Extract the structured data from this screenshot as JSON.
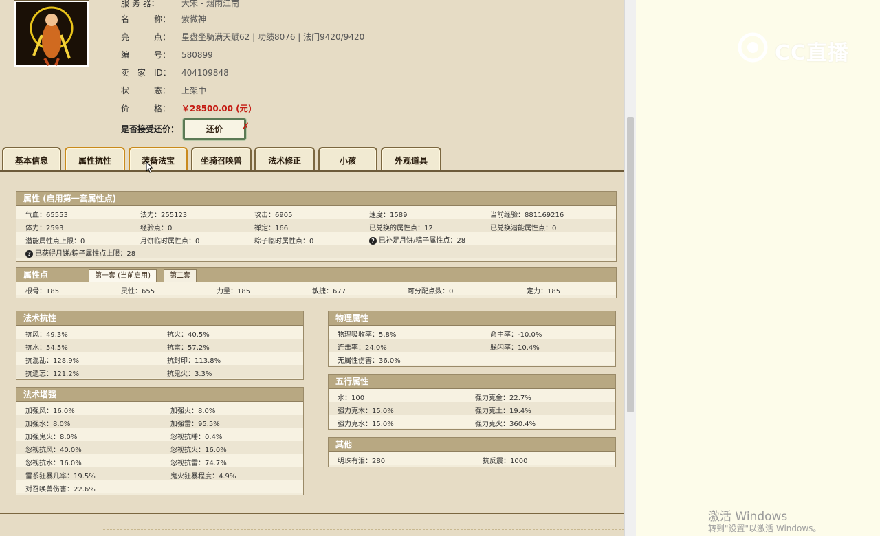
{
  "listing": {
    "server_label": "服 务 器：",
    "server_value": "大宋 - 烟雨江南",
    "name_label": "名　　　称：",
    "name_value": "紫微神",
    "highlight_label": "亮　　　点：",
    "highlight_value": "星盘坐骑满天赋62 | 功绩8076 | 法门9420/9420",
    "number_label": "编　　　号：",
    "number_value": "580899",
    "seller_label": "卖　家　ID：",
    "seller_value": "404109848",
    "status_label": "状　　　态：",
    "status_value": "上架中",
    "price_label": "价　　　格：",
    "price_value": "￥28500.00 (元)",
    "bargain_label": "是否接受还价：",
    "bargain_button": "还价",
    "bargain_x": "✗"
  },
  "tabs": [
    "基本信息",
    "属性抗性",
    "装备法宝",
    "坐骑召唤兽",
    "法术修正",
    "小孩",
    "外观道具"
  ],
  "attributes": {
    "title": "属性 (启用第一套属性点)",
    "rows": [
      [
        "气血：65553",
        "法力：255123",
        "攻击：6905",
        "速度：1589",
        "当前经验：881169216"
      ],
      [
        "体力：2593",
        "经验点：0",
        "禅定：166",
        "已兑换的属性点：12",
        "已兑换潜能属性点：0"
      ],
      [
        "潜能属性点上限：0",
        "月饼临时属性点：0",
        "粽子临时属性点：0",
        "已补足月饼/粽子属性点：28",
        ""
      ],
      [
        "已获得月饼/粽子属性点上限：28"
      ]
    ]
  },
  "points": {
    "title": "属性点",
    "tab1": "第一套 (当前启用)",
    "tab2": "第二套",
    "values": [
      "根骨：185",
      "灵性：655",
      "力量：185",
      "敏捷：677",
      "可分配点数：0",
      "定力：185"
    ]
  },
  "magic_resist": {
    "title": "法术抗性",
    "rows": [
      [
        "抗风：49.3%",
        "抗火：40.5%"
      ],
      [
        "抗水：54.5%",
        "抗雷：57.2%"
      ],
      [
        "抗混乱：128.9%",
        "抗封印：113.8%"
      ],
      [
        "抗遗忘：121.2%",
        "抗鬼火：3.3%"
      ]
    ]
  },
  "magic_boost": {
    "title": "法术增强",
    "rows": [
      [
        "加强风：16.0%",
        "加强火：8.0%"
      ],
      [
        "加强水：8.0%",
        "加强雷：95.5%"
      ],
      [
        "加强鬼火：8.0%",
        "忽视抗睡：0.4%"
      ],
      [
        "忽视抗风：40.0%",
        "忽视抗火：16.0%"
      ],
      [
        "忽视抗水：16.0%",
        "忽视抗雷：74.7%"
      ],
      [
        "雷系狂暴几率：19.5%",
        "鬼火狂暴程度：4.9%"
      ],
      [
        "对召唤兽伤害：22.6%",
        ""
      ]
    ]
  },
  "physical": {
    "title": "物理属性",
    "rows": [
      [
        "物理吸收率：5.8%",
        "命中率：-10.0%"
      ],
      [
        "连击率：24.0%",
        "躲闪率：10.4%"
      ],
      [
        "无属性伤害：36.0%",
        ""
      ]
    ]
  },
  "five_elements": {
    "title": "五行属性",
    "rows": [
      [
        "水：100",
        "强力克金：22.7%"
      ],
      [
        "强力克木：15.0%",
        "强力克土：19.4%"
      ],
      [
        "强力克水：15.0%",
        "强力克火：360.4%"
      ]
    ]
  },
  "other": {
    "title": "其他",
    "rows": [
      [
        "明珠有泪：280",
        "抗反震：1000"
      ]
    ]
  },
  "watermark": {
    "logo_text": "CC直播",
    "activate_title": "激活 Windows",
    "activate_sub": "转到\"设置\"以激活 Windows。"
  }
}
